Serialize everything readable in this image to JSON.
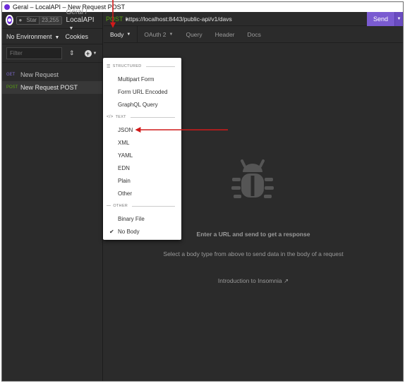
{
  "window": {
    "title": "Geral – LocalAPI – New Request POST"
  },
  "sidebar": {
    "star_label": "Star",
    "star_count": "23,255",
    "breadcrumb_root": "Geral",
    "breadcrumb_sep": "/",
    "breadcrumb_current": "LocalAPI",
    "environment": "No Environment",
    "cookies": "Cookies",
    "filter_placeholder": "Filter",
    "requests": [
      {
        "method": "GET",
        "name": "New Request"
      },
      {
        "method": "POST",
        "name": "New Request POST"
      }
    ]
  },
  "request": {
    "method": "POST",
    "url": "https://localhost:8443/public-api/v1/davs",
    "send_label": "Send"
  },
  "tabs": [
    {
      "label": "Body"
    },
    {
      "label": "OAuth 2"
    },
    {
      "label": "Query"
    },
    {
      "label": "Header"
    },
    {
      "label": "Docs"
    }
  ],
  "body_menu": {
    "sections": [
      {
        "title": "STRUCTURED",
        "symbol": "☰"
      },
      {
        "title": "TEXT",
        "symbol": "</>"
      },
      {
        "title": "OTHER",
        "symbol": "—"
      }
    ],
    "structured": [
      "Multipart Form",
      "Form URL Encoded",
      "GraphQL Query"
    ],
    "text": [
      "JSON",
      "XML",
      "YAML",
      "EDN",
      "Plain",
      "Other"
    ],
    "other": [
      "Binary File",
      "No Body"
    ],
    "selected": "No Body"
  },
  "empty_state": {
    "title": "Enter a URL and send to get a response",
    "subtitle": "Select a body type from above to send data in the body of a request",
    "intro_link": "Introduction to Insomnia"
  },
  "colors": {
    "accent": "#7a5bd1",
    "post": "#59a210",
    "get": "#7d69cb",
    "annotation": "#d11a1a"
  }
}
